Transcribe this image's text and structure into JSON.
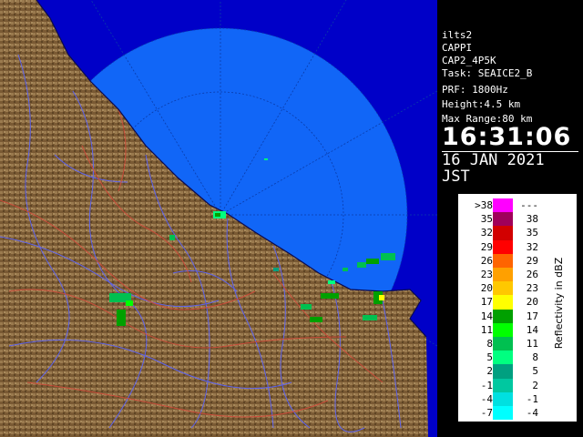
{
  "info": {
    "lines": [
      "ilts2",
      "CAPPI",
      "CAP2_4P5K",
      "Task: SEAICE2_B",
      "PRF: 1800Hz",
      "Height:4.5 km",
      "Max Range:80 km"
    ],
    "time": "16:31:06",
    "date": "16 JAN 2021 JST"
  },
  "legend": {
    "title": "Reflectivity in dBZ",
    "rows": [
      {
        "lo": ">38",
        "hi": "---",
        "color": "#ff00ff"
      },
      {
        "lo": "35",
        "hi": "38",
        "color": "#a0005a"
      },
      {
        "lo": "32",
        "hi": "35",
        "color": "#d20000"
      },
      {
        "lo": "29",
        "hi": "32",
        "color": "#ff0000"
      },
      {
        "lo": "26",
        "hi": "29",
        "color": "#ff6400"
      },
      {
        "lo": "23",
        "hi": "26",
        "color": "#ffa000"
      },
      {
        "lo": "20",
        "hi": "23",
        "color": "#ffc800"
      },
      {
        "lo": "17",
        "hi": "20",
        "color": "#ffff00"
      },
      {
        "lo": "14",
        "hi": "17",
        "color": "#00a000"
      },
      {
        "lo": "11",
        "hi": "14",
        "color": "#00ff00"
      },
      {
        "lo": "8",
        "hi": "11",
        "color": "#00c050"
      },
      {
        "lo": "5",
        "hi": "8",
        "color": "#00ff80"
      },
      {
        "lo": "2",
        "hi": "5",
        "color": "#00a080"
      },
      {
        "lo": "-1",
        "hi": "2",
        "color": "#00c8a0"
      },
      {
        "lo": "-4",
        "hi": "-1",
        "color": "#00e0e0"
      },
      {
        "lo": "-7",
        "hi": "-4",
        "color": "#00ffff"
      }
    ]
  },
  "colors": {
    "sea": "#0000c8",
    "radar_coverage": "#1478ff",
    "land": "#7a5a34",
    "rivers": "#5a64ff",
    "borders": "#d24a3a"
  }
}
